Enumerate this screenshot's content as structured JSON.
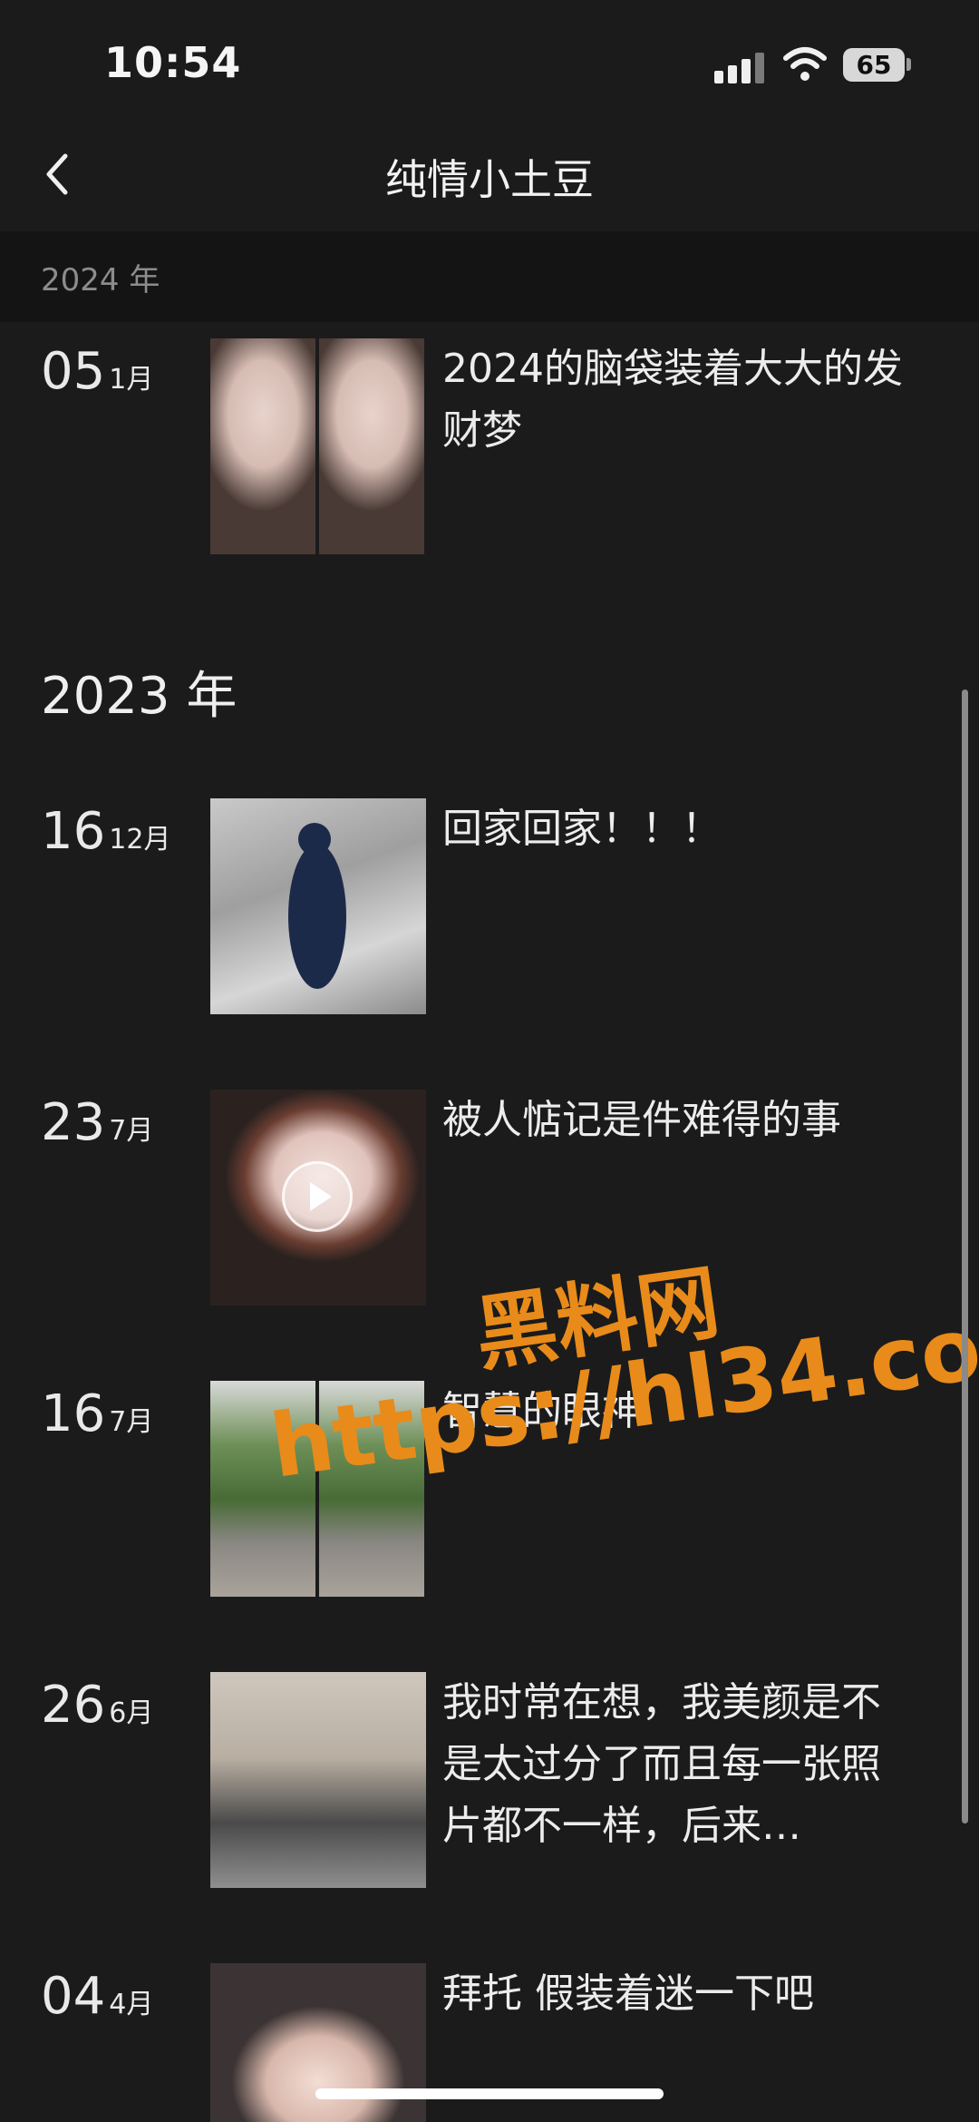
{
  "status_bar": {
    "time": "10:54",
    "battery": "65"
  },
  "header": {
    "title": "纯情小土豆"
  },
  "sticky_year": "2024 年",
  "year_2023": "2023 年",
  "entries": [
    {
      "day": "05",
      "month": "1月",
      "caption": "2024的脑袋装着大大的发财梦"
    },
    {
      "day": "16",
      "month": "12月",
      "caption": "回家回家！！！"
    },
    {
      "day": "23",
      "month": "7月",
      "caption": "被人惦记是件难得的事"
    },
    {
      "day": "16",
      "month": "7月",
      "caption": "智慧的眼神"
    },
    {
      "day": "26",
      "month": "6月",
      "caption": "我时常在想，我美颜是不是太过分了而且每一张照片都不一样，后来…"
    },
    {
      "day": "04",
      "month": "4月",
      "caption": "拜托 假装着迷一下吧"
    }
  ],
  "watermark": {
    "line1": "黑料网",
    "line2": "https://hl34.co"
  }
}
